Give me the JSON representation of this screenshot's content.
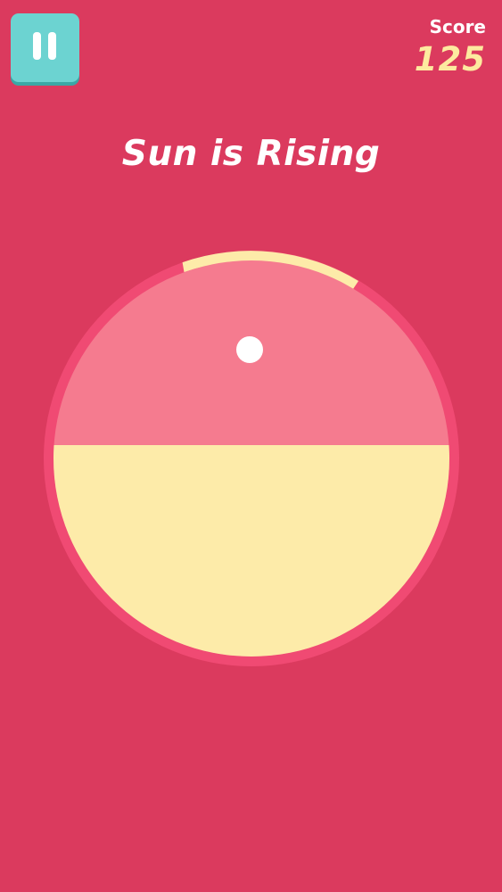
{
  "hud": {
    "pause_icon": "pause-icon",
    "score_label": "Score",
    "score_value": "125"
  },
  "level": {
    "title": "Sun is Rising"
  },
  "board": {
    "sky_color": "#f57b8f",
    "ground_color": "#fdeba9",
    "ring_color": "#f04a73",
    "background_color": "#db3a5e",
    "progress_color": "#fdeba9",
    "ball_color": "#ffffff",
    "ground_fill_fraction": 0.5
  }
}
